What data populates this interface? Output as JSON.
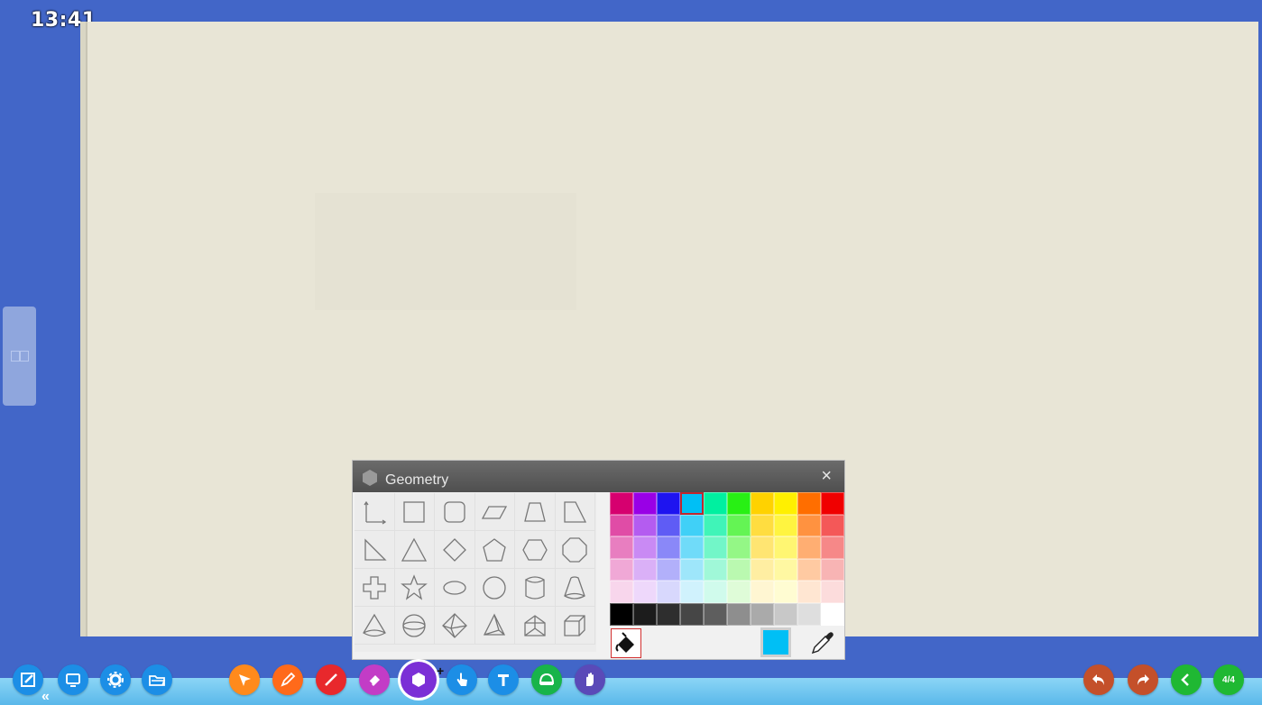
{
  "clock": "13:41",
  "panel": {
    "title": "Geometry",
    "close": "×",
    "shapes": [
      "axis",
      "rectangle",
      "rounded-rectangle",
      "parallelogram",
      "trapezoid",
      "right-trapezoid",
      "right-triangle",
      "triangle",
      "diamond",
      "pentagon",
      "hexagon",
      "octagon",
      "cross",
      "star",
      "ellipse",
      "circle",
      "cylinder",
      "cone-frustum",
      "cone",
      "sphere",
      "octahedron",
      "pyramid",
      "prism",
      "cube"
    ],
    "palette": [
      [
        "#d6006f",
        "#9900e6",
        "#1e14f0",
        "#00bff5",
        "#00f0a0",
        "#28f014",
        "#ffd200",
        "#fff000",
        "#ff6e00",
        "#f00000"
      ],
      [
        "#e04ca6",
        "#b45cf0",
        "#5f5cf5",
        "#40d0f7",
        "#40f4b8",
        "#64f454",
        "#ffdd40",
        "#fff440",
        "#ff9240",
        "#f45858"
      ],
      [
        "#e87ec0",
        "#c98af4",
        "#8a88f8",
        "#70dbf9",
        "#72f6c8",
        "#94f786",
        "#ffe572",
        "#fff672",
        "#ffae72",
        "#f68888"
      ],
      [
        "#f0a8d6",
        "#dab0f7",
        "#b2b0fa",
        "#9ee6fa",
        "#a0f8d8",
        "#baf9b0",
        "#ffeea2",
        "#fff8a2",
        "#ffcaa2",
        "#f8b4b4"
      ],
      [
        "#f8d6ec",
        "#eed8fb",
        "#d8d8fd",
        "#d0f2fd",
        "#d0fbec",
        "#dffcd8",
        "#fff6d2",
        "#fffcd2",
        "#ffe6d2",
        "#fcdcdc"
      ],
      [
        "#000000",
        "#1c1c1c",
        "#2e2e2e",
        "#464646",
        "#5e5e5e",
        "#8e8e8e",
        "#aaaaaa",
        "#c8c8c8",
        "#dedede",
        "#ffffff"
      ]
    ],
    "selected_swatch": [
      0,
      3
    ],
    "current_color": "#00bff5"
  },
  "toolbar": {
    "left": [
      {
        "name": "edit-button",
        "icon": "edit-icon",
        "color": "#1c8ee6"
      },
      {
        "name": "screen-button",
        "icon": "monitor-icon",
        "color": "#1c8ee6"
      },
      {
        "name": "settings-button",
        "icon": "gear-icon",
        "color": "#1c8ee6"
      },
      {
        "name": "open-folder-button",
        "icon": "folder-icon",
        "color": "#1c8ee6"
      }
    ],
    "tools": [
      {
        "name": "select-tool",
        "icon": "arrow-icon",
        "color": "#ff8a1c"
      },
      {
        "name": "pen-tool",
        "icon": "pencil-icon",
        "color": "#ff6a1a"
      },
      {
        "name": "line-tool",
        "icon": "line-icon",
        "color": "#e8282c"
      },
      {
        "name": "eraser-tool",
        "icon": "eraser-icon",
        "color": "#c23cc6"
      },
      {
        "name": "geometry-tool",
        "icon": "hexagon-icon",
        "color": "#7b2fd6"
      },
      {
        "name": "touch-tool",
        "icon": "hand-pointer-icon",
        "color": "#1c8ee6"
      },
      {
        "name": "text-tool",
        "icon": "text-icon",
        "color": "#1c8ee6"
      },
      {
        "name": "protractor-tool",
        "icon": "protractor-icon",
        "color": "#18b44a"
      },
      {
        "name": "pan-tool",
        "icon": "hand-icon",
        "color": "#5a4ab8"
      }
    ],
    "right": [
      {
        "name": "undo-button",
        "icon": "undo-icon",
        "color": "#c4502a"
      },
      {
        "name": "redo-button",
        "icon": "redo-icon",
        "color": "#c4502a"
      },
      {
        "name": "prev-page-button",
        "icon": "chevron-left-icon",
        "color": "#1fb833"
      },
      {
        "name": "page-indicator",
        "icon": "page-icon",
        "color": "#1fb833"
      }
    ],
    "page_indicator": "4/4",
    "collapse": "«"
  }
}
